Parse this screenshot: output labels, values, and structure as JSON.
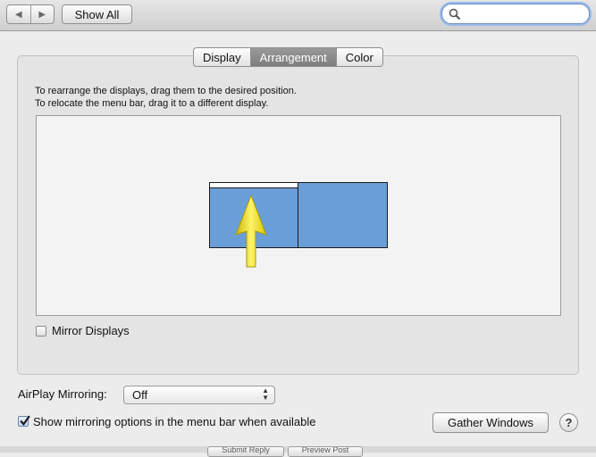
{
  "toolbar": {
    "back_icon": "back-arrow-icon",
    "forward_icon": "forward-arrow-icon",
    "show_all_label": "Show All",
    "search_value": ""
  },
  "tabs": [
    {
      "label": "Display",
      "selected": false
    },
    {
      "label": "Arrangement",
      "selected": true
    },
    {
      "label": "Color",
      "selected": false
    }
  ],
  "instructions": {
    "line1": "To rearrange the displays, drag them to the desired position.",
    "line2": "To relocate the menu bar, drag it to a different display."
  },
  "mirror_displays": {
    "label": "Mirror Displays",
    "checked": false
  },
  "airplay": {
    "label": "AirPlay Mirroring:",
    "selected": "Off"
  },
  "show_mirroring": {
    "label": "Show mirroring options in the menu bar when available",
    "checked": true
  },
  "gather_label": "Gather Windows",
  "help_label": "?",
  "bottom_buttons": [
    "Submit Reply",
    "Preview Post"
  ],
  "colors": {
    "display_blue": "#6a9ed8",
    "arrow_yellow": "#f5e41a",
    "selected_tab": "#8a8a8a"
  }
}
